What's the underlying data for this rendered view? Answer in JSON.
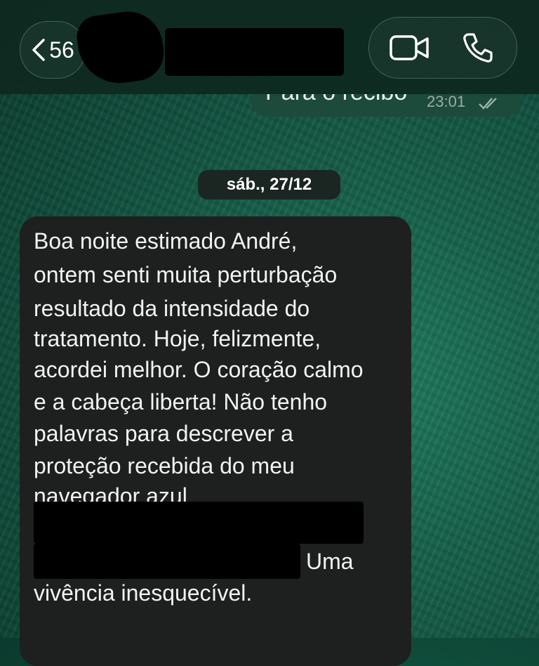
{
  "header": {
    "back_count": "56",
    "back_icon": "chevron-left-icon",
    "video_icon": "video-camera-icon",
    "phone_icon": "phone-icon"
  },
  "previous_message": {
    "text": "Para o recibo",
    "time": "23:01",
    "status_icon": "double-check-icon"
  },
  "date_separator": "sáb., 27/12",
  "message": {
    "lines": [
      "Boa noite estimado André,",
      "ontem senti muita perturbação",
      "resultado da intensidade do",
      "tratamento. Hoje, felizmente,",
      "acordei melhor. O coração calmo",
      "e a cabeça liberta! Não tenho",
      "palavras para descrever a",
      "proteção recebida do meu",
      "navegador azul"
    ],
    "after_redaction": "Uma",
    "last_line": "vivência inesquecível."
  },
  "colors": {
    "background": "#16604a",
    "bubble_incoming": "#1e1f1f",
    "bubble_outgoing": "#1c4a3b",
    "date_pill": "#1b2521"
  }
}
